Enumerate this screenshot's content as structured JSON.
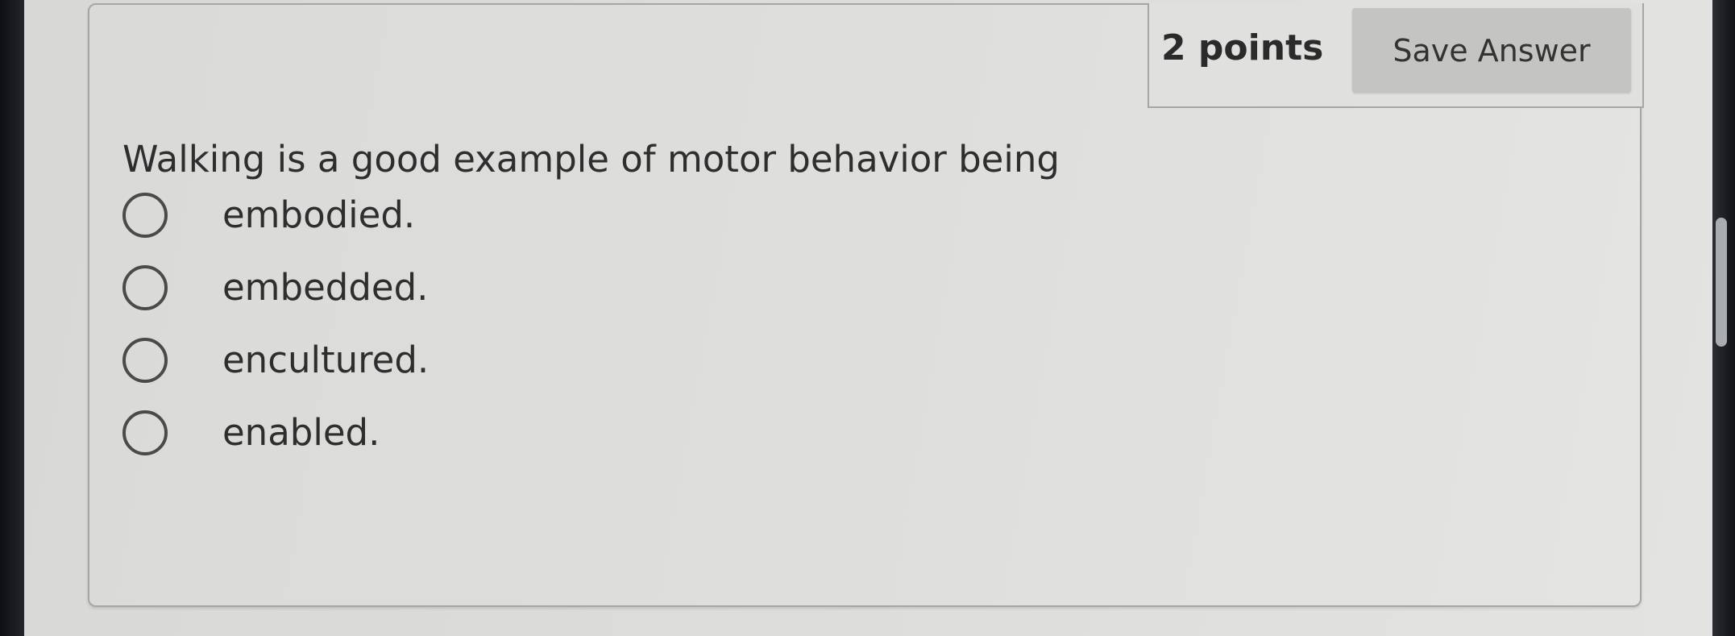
{
  "question": {
    "points_label": "2 points",
    "save_label": "Save Answer",
    "prompt": "Walking is a good example of motor behavior being",
    "options": [
      {
        "label": "embodied.",
        "selected": false
      },
      {
        "label": "embedded.",
        "selected": false
      },
      {
        "label": "encultured.",
        "selected": false
      },
      {
        "label": "enabled.",
        "selected": false
      }
    ]
  }
}
